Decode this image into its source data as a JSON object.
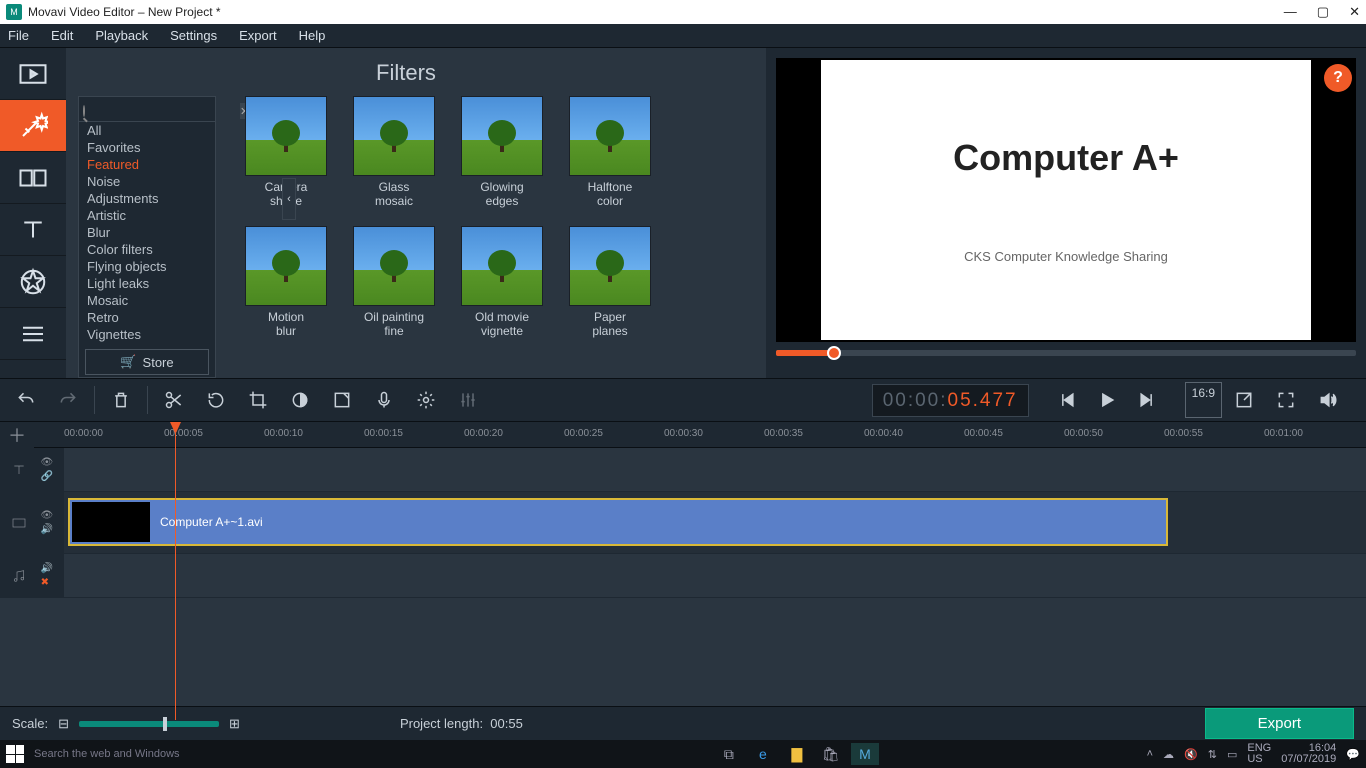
{
  "titlebar": {
    "app": "Movavi Video Editor",
    "project": "New Project *"
  },
  "menu": [
    "File",
    "Edit",
    "Playback",
    "Settings",
    "Export",
    "Help"
  ],
  "left_tools": [
    "import",
    "filters",
    "transitions",
    "titles",
    "stickers",
    "more"
  ],
  "filters": {
    "title": "Filters",
    "search_placeholder": "",
    "categories": [
      "All",
      "Favorites",
      "Featured",
      "Noise",
      "Adjustments",
      "Artistic",
      "Blur",
      "Color filters",
      "Flying objects",
      "Light leaks",
      "Mosaic",
      "Retro",
      "Vignettes"
    ],
    "active_category": "Featured",
    "store": "Store",
    "items": [
      {
        "label": "Camera shake"
      },
      {
        "label": "Glass mosaic"
      },
      {
        "label": "Glowing edges"
      },
      {
        "label": "Halftone - color"
      },
      {
        "label": "Motion blur"
      },
      {
        "label": "Oil painting - fine"
      },
      {
        "label": "Old movie - vignette"
      },
      {
        "label": "Paper planes"
      }
    ]
  },
  "preview": {
    "slide_title": "Computer A+",
    "slide_sub": "CKS Computer Knowledge Sharing",
    "timecode_gray": "00:00:",
    "timecode_orange": "05.477",
    "ratio": "16:9"
  },
  "toolbar": [
    "undo",
    "redo",
    "delete",
    "cut",
    "rotate",
    "crop",
    "color",
    "clip-props",
    "record",
    "settings",
    "mixer"
  ],
  "ruler_marks": [
    "00:00:00",
    "00:00:05",
    "00:00:10",
    "00:00:15",
    "00:00:20",
    "00:00:25",
    "00:00:30",
    "00:00:35",
    "00:00:40",
    "00:00:45",
    "00:00:50",
    "00:00:55",
    "00:01:00"
  ],
  "clip_name": "Computer A+~1.avi",
  "bottom": {
    "scale_label": "Scale:",
    "proj_label": "Project length:",
    "proj_len": "00:55",
    "export": "Export"
  },
  "taskbar": {
    "search": "Search the web and Windows",
    "lang1": "ENG",
    "lang2": "US",
    "time": "16:04",
    "date": "07/07/2019"
  }
}
